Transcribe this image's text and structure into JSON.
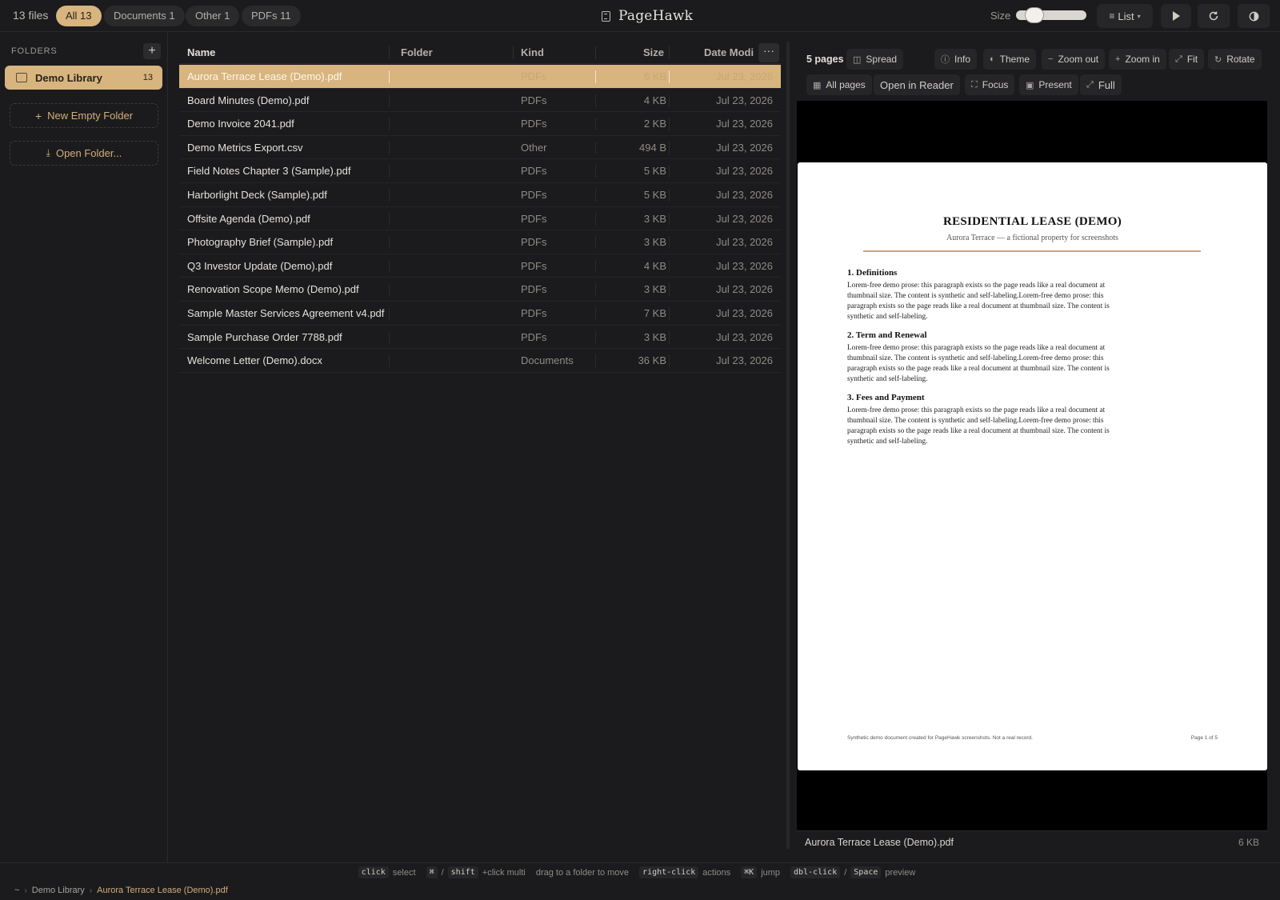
{
  "topbar": {
    "file_count": "13 files",
    "filters": [
      {
        "label": "All 13",
        "active": true
      },
      {
        "label": "Documents 1",
        "active": false
      },
      {
        "label": "Other 1",
        "active": false
      },
      {
        "label": "PDFs 11",
        "active": false
      }
    ],
    "app_name": "PageHawk",
    "size_label": "Size",
    "size_slider_value": 0.18,
    "view_mode_label": "List",
    "icons": {
      "logo": "document-icon",
      "play": "play-icon",
      "refresh": "refresh-icon",
      "theme": "contrast-icon"
    }
  },
  "sidebar": {
    "title": "FOLDERS",
    "add_label": "+",
    "folders": [
      {
        "name": "Demo Library",
        "count": "13"
      }
    ],
    "new_folder_label": "New Empty Folder",
    "open_folder_label": "Open Folder..."
  },
  "table": {
    "columns": [
      "Name",
      "Folder",
      "Kind",
      "Size",
      "Date Modi"
    ],
    "more_label": "···",
    "rows": [
      {
        "name": "Aurora Terrace Lease (Demo).pdf",
        "kind": "PDFs",
        "size": "6 KB",
        "date": "Jul 23, 2026",
        "selected": true
      },
      {
        "name": "Board Minutes (Demo).pdf",
        "kind": "PDFs",
        "size": "4 KB",
        "date": "Jul 23, 2026",
        "selected": false
      },
      {
        "name": "Demo Invoice 2041.pdf",
        "kind": "PDFs",
        "size": "2 KB",
        "date": "Jul 23, 2026",
        "selected": false
      },
      {
        "name": "Demo Metrics Export.csv",
        "kind": "Other",
        "size": "494 B",
        "date": "Jul 23, 2026",
        "selected": false
      },
      {
        "name": "Field Notes Chapter 3 (Sample).pdf",
        "kind": "PDFs",
        "size": "5 KB",
        "date": "Jul 23, 2026",
        "selected": false
      },
      {
        "name": "Harborlight Deck (Sample).pdf",
        "kind": "PDFs",
        "size": "5 KB",
        "date": "Jul 23, 2026",
        "selected": false
      },
      {
        "name": "Offsite Agenda (Demo).pdf",
        "kind": "PDFs",
        "size": "3 KB",
        "date": "Jul 23, 2026",
        "selected": false
      },
      {
        "name": "Photography Brief (Sample).pdf",
        "kind": "PDFs",
        "size": "3 KB",
        "date": "Jul 23, 2026",
        "selected": false
      },
      {
        "name": "Q3 Investor Update (Demo).pdf",
        "kind": "PDFs",
        "size": "4 KB",
        "date": "Jul 23, 2026",
        "selected": false
      },
      {
        "name": "Renovation Scope Memo (Demo).pdf",
        "kind": "PDFs",
        "size": "3 KB",
        "date": "Jul 23, 2026",
        "selected": false
      },
      {
        "name": "Sample Master Services Agreement v4.pdf",
        "kind": "PDFs",
        "size": "7 KB",
        "date": "Jul 23, 2026",
        "selected": false
      },
      {
        "name": "Sample Purchase Order 7788.pdf",
        "kind": "PDFs",
        "size": "3 KB",
        "date": "Jul 23, 2026",
        "selected": false
      },
      {
        "name": "Welcome Letter (Demo).docx",
        "kind": "Documents",
        "size": "36 KB",
        "date": "Jul 23, 2026",
        "selected": false
      }
    ]
  },
  "preview": {
    "pages_count": "5 pages",
    "toolbar_row1": [
      "Spread",
      "Info",
      "Theme",
      "Zoom out",
      "Zoom in",
      "Fit",
      "Rotate"
    ],
    "toolbar_row2": [
      "All pages",
      "Open in Reader",
      "Focus",
      "Present",
      "Full"
    ],
    "document": {
      "title": "RESIDENTIAL LEASE (DEMO)",
      "subtitle": "Aurora Terrace — a fictional property for screenshots",
      "sections": [
        {
          "heading": "1. Definitions",
          "body": "Lorem-free demo prose: this paragraph exists so the page reads like a real document at thumbnail size. The content is synthetic and self-labeling.Lorem-free demo prose: this paragraph exists so the page reads like a real document at thumbnail size. The content is synthetic and self-labeling."
        },
        {
          "heading": "2. Term and Renewal",
          "body": "Lorem-free demo prose: this paragraph exists so the page reads like a real document at thumbnail size. The content is synthetic and self-labeling.Lorem-free demo prose: this paragraph exists so the page reads like a real document at thumbnail size. The content is synthetic and self-labeling."
        },
        {
          "heading": "3. Fees and Payment",
          "body": "Lorem-free demo prose: this paragraph exists so the page reads like a real document at thumbnail size. The content is synthetic and self-labeling.Lorem-free demo prose: this paragraph exists so the page reads like a real document at thumbnail size. The content is synthetic and self-labeling."
        }
      ],
      "footer_left": "Synthetic demo document created for PageHawk screenshots. Not a real record.",
      "footer_right": "Page 1 of 5"
    },
    "footer_filename": "Aurora Terrace Lease (Demo).pdf",
    "footer_filesize": "6 KB"
  },
  "hints": [
    {
      "keys": [
        "click"
      ],
      "text": "select"
    },
    {
      "keys": [
        "⌘",
        "shift"
      ],
      "text": "+click multi",
      "sep": "/"
    },
    {
      "keys": [],
      "text": "drag to a folder to move"
    },
    {
      "keys": [
        "right-click"
      ],
      "text": "actions"
    },
    {
      "keys": [
        "⌘K"
      ],
      "text": "jump"
    },
    {
      "keys": [
        "dbl-click",
        "Space"
      ],
      "text": "preview",
      "sep": "/"
    }
  ],
  "breadcrumb": [
    "~",
    "Demo Library",
    "Aurora Terrace Lease (Demo).pdf"
  ],
  "colors": {
    "accent": "#d8b47f",
    "background": "#1b1b1d",
    "panel": "#262628"
  }
}
